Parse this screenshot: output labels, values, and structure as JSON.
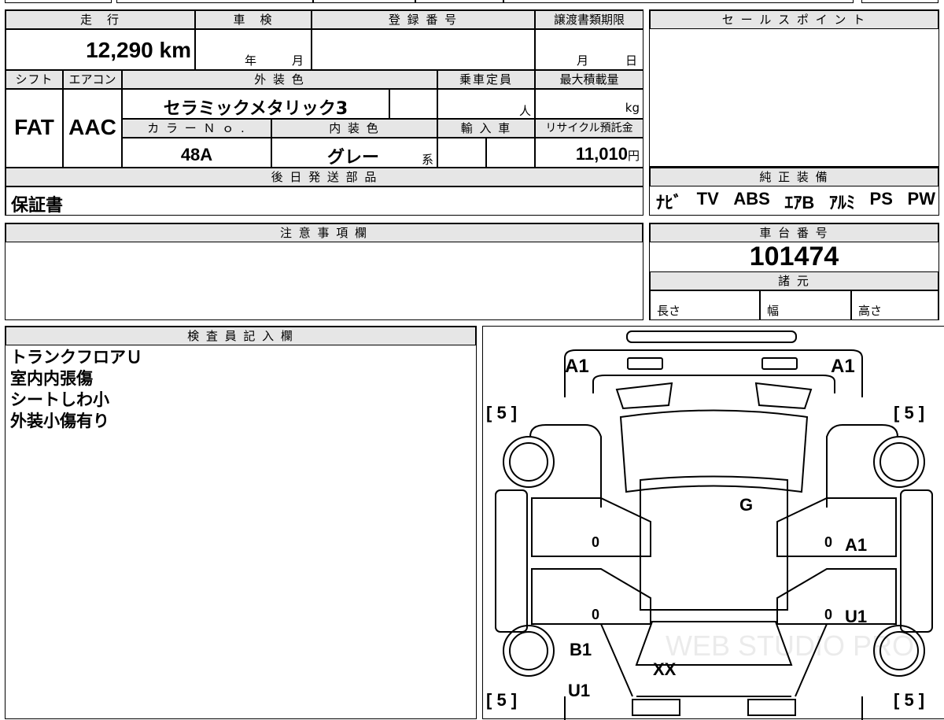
{
  "top_form": {
    "mileage": {
      "header": "走　行",
      "value": "12,290 km"
    },
    "shaken": {
      "header": "車　検",
      "year_unit": "年",
      "month_unit": "月"
    },
    "registration": {
      "header": "登 録 番 号"
    },
    "transfer_deadline": {
      "header": "譲渡書類期限",
      "month_unit": "月",
      "day_unit": "日"
    },
    "shift": {
      "header": "シフト",
      "value": "FAT"
    },
    "aircon": {
      "header": "エアコン",
      "value": "AAC"
    },
    "exterior_color": {
      "header": "外 装 色",
      "value": "セラミックメタリック3"
    },
    "capacity": {
      "header": "乗車定員",
      "unit": "人"
    },
    "max_load": {
      "header": "最大積載量",
      "unit": "kg"
    },
    "color_no": {
      "header": "カ ラ ー Ｎ ｏ .",
      "value": "48A"
    },
    "interior_color": {
      "header": "内 装 色",
      "value": "グレー",
      "suffix": "系"
    },
    "import": {
      "header": "輸 入 車"
    },
    "recycle_fee": {
      "header": "リサイクル預託金",
      "value": "11,010",
      "unit": "円"
    },
    "later_parts": {
      "header": "後 日 発 送 部 品",
      "value": "保証書"
    }
  },
  "sales_point": {
    "header": "セ ー ル ス ポ イ ン ト"
  },
  "equipment": {
    "header": "純 正 装 備",
    "items": [
      "ﾅﾋﾞ",
      "TV",
      "ABS",
      "ｴｱB",
      "ｱﾙﾐ",
      "PS",
      "PW"
    ]
  },
  "notes": {
    "header": "注 意 事 項 欄"
  },
  "chassis": {
    "header": "車 台 番 号",
    "value": "101474"
  },
  "specs": {
    "header": "諸 元",
    "length": "長さ",
    "width": "幅",
    "height": "高さ"
  },
  "inspector": {
    "header": "検 査 員 記 入 欄",
    "lines": [
      "トランクフロアＵ",
      "室内内張傷",
      "シートしわ小",
      "外装小傷有り"
    ]
  },
  "diagram": {
    "labels": {
      "front_left": "A1",
      "front_right": "A1",
      "tire_fl": "[ 5 ]",
      "tire_fr": "[ 5 ]",
      "tire_rl": "[ 5 ]",
      "tire_rr": "[ 5 ]",
      "windshield": "G",
      "right_front_door": "A1",
      "right_rear_door": "U1",
      "left_front_door": "0",
      "left_rear_door": "0",
      "right_front_door_num": "0",
      "right_rear_door_num": "0",
      "rear_quarter_left": "B1",
      "rear_left": "U1",
      "rear_glass": "XX"
    },
    "watermark": "WEB STUDIO PRO"
  }
}
